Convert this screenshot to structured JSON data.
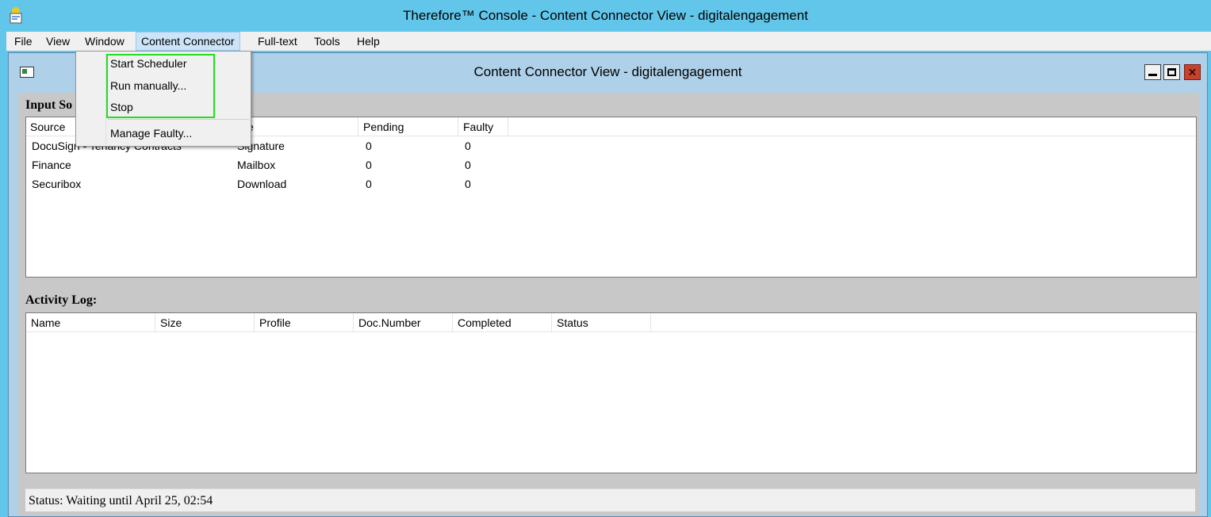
{
  "window": {
    "title": "Therefore™ Console - Content Connector View - digitalengagement"
  },
  "menubar": {
    "items": [
      "File",
      "View",
      "Window",
      "Content Connector",
      "Full-text",
      "Tools",
      "Help"
    ]
  },
  "dropdown": {
    "items": [
      "Start Scheduler",
      "Run manually...",
      "Stop",
      "Manage Faulty..."
    ]
  },
  "child": {
    "title": "Content Connector View - digitalengagement",
    "input_label": "Input So",
    "activity_label": "Activity Log:"
  },
  "input_sources": {
    "columns": [
      "Source",
      "e",
      "Pending",
      "Faulty"
    ],
    "rows": [
      {
        "source": "DocuSign - Tenancy Contracts",
        "type": "Signature",
        "pending": "0",
        "faulty": "0"
      },
      {
        "source": "Finance",
        "type": "Mailbox",
        "pending": "0",
        "faulty": "0"
      },
      {
        "source": "Securibox",
        "type": "Download",
        "pending": "0",
        "faulty": "0"
      }
    ]
  },
  "activity_log": {
    "columns": [
      "Name",
      "Size",
      "Profile",
      "Doc.Number",
      "Completed",
      "Status"
    ]
  },
  "status": {
    "text": "Status: Waiting until April 25, 02:54"
  },
  "colors": {
    "titlebar": "#62c6ea",
    "mdi_frame": "#aed0e8",
    "highlight_box": "#22dd22",
    "close_button": "#c7412c"
  }
}
